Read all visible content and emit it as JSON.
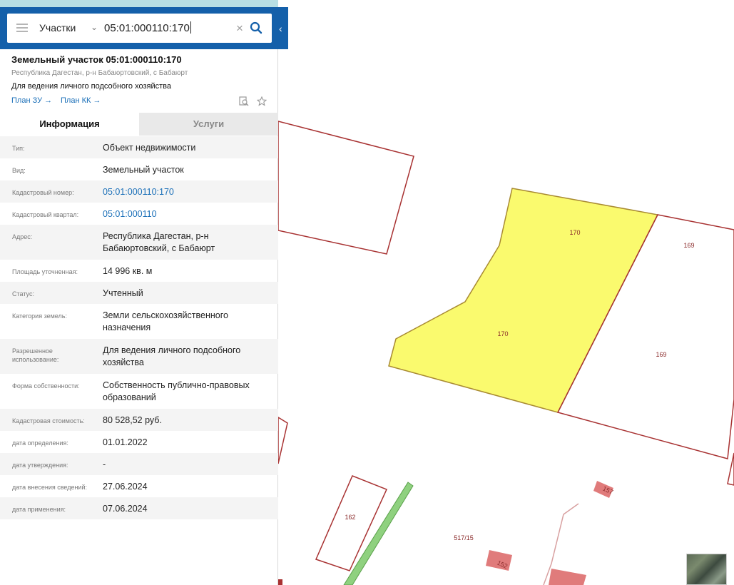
{
  "search": {
    "layer": "Участки",
    "query": "05:01:000110:170"
  },
  "card": {
    "title": "Земельный участок 05:01:000110:170",
    "address": "Республика Дагестан, р-н Бабаюртовский, с Бабаюрт",
    "purpose": "Для ведения личного подсобного хозяйства",
    "links": [
      "План ЗУ",
      "План КК"
    ]
  },
  "tabs": [
    "Информация",
    "Услуги"
  ],
  "info": [
    {
      "label": "Тип:",
      "value": "Объект недвижимости"
    },
    {
      "label": "Вид:",
      "value": "Земельный участок"
    },
    {
      "label": "Кадастровый номер:",
      "value": "05:01:000110:170",
      "link": true
    },
    {
      "label": "Кадастровый квартал:",
      "value": "05:01:000110",
      "link": true
    },
    {
      "label": "Адрес:",
      "value": "Республика Дагестан, р-н Бабаюртовский, с Бабаюрт"
    },
    {
      "label": "Площадь уточненная:",
      "value": "14 996 кв. м"
    },
    {
      "label": "Статус:",
      "value": "Учтенный"
    },
    {
      "label": "Категория земель:",
      "value": "Земли сельскохозяйственного назначения"
    },
    {
      "label": "Разрешенное использование:",
      "value": "Для ведения личного подсобного хозяйства"
    },
    {
      "label": "Форма собственности:",
      "value": "Собственность публично-правовых образований"
    },
    {
      "label": "Кадастровая стоимость:",
      "value": "80 528,52 руб."
    },
    {
      "label": "дата определения:",
      "value": "01.01.2022"
    },
    {
      "label": "дата утверждения:",
      "value": "-"
    },
    {
      "label": "дата внесения сведений:",
      "value": "27.06.2024"
    },
    {
      "label": "дата применения:",
      "value": "07.06.2024"
    }
  ],
  "map": {
    "labels": [
      "170",
      "170",
      "169",
      "169",
      "162",
      "517/15",
      "157",
      "152"
    ],
    "colors": {
      "parcel_border": "#a83232",
      "selected_fill": "#fafa6e",
      "road": "#8fd17f"
    }
  }
}
